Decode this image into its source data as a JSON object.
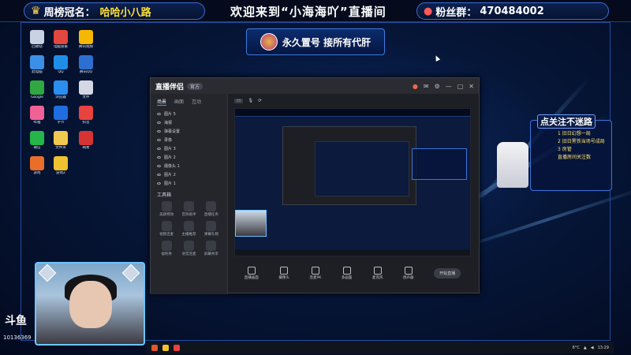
{
  "header": {
    "rank_label": "周榜冠名：",
    "rank_value": "哈哈小八路",
    "welcome": "欢迎来到“小海海吖”直播间",
    "fans_label": "粉丝群：",
    "fans_number": "470484002"
  },
  "banner": {
    "text": "永久置号 接所有代肝"
  },
  "desktop_icons": [
    {
      "label": "回收站",
      "color": "#c9d2e3"
    },
    {
      "label": "电脑管家",
      "color": "#e2483d"
    },
    {
      "label": "腾讯视频",
      "color": "#f5b700"
    },
    {
      "label": "此电脑",
      "color": "#3c8fe6"
    },
    {
      "label": "QQ",
      "color": "#1f8ee8"
    },
    {
      "label": "腾讯QQ",
      "color": "#2c6fd1"
    },
    {
      "label": "Google",
      "color": "#2fa844"
    },
    {
      "label": "浏览器",
      "color": "#2a8ef0"
    },
    {
      "label": "文件",
      "color": "#d3d8e4"
    },
    {
      "label": "哔哩",
      "color": "#f06296"
    },
    {
      "label": "字节",
      "color": "#1f6de0"
    },
    {
      "label": "抖音",
      "color": "#e9423f"
    },
    {
      "label": "微信",
      "color": "#25b54a"
    },
    {
      "label": "文件夹",
      "color": "#f1c850"
    },
    {
      "label": "网易",
      "color": "#d63434"
    },
    {
      "label": "游戏",
      "color": "#e96e2a"
    },
    {
      "label": "游戏2",
      "color": "#f0c230"
    }
  ],
  "app": {
    "title": "直播伴侣",
    "version": "官方",
    "tabs": [
      "场景",
      "画面",
      "互动"
    ],
    "scenes": [
      "图片 5",
      "海报",
      "弹幕设置",
      "录像",
      "图片 3",
      "图片 2",
      "摄像头 1",
      "图片 2",
      "图片 1"
    ],
    "tools_section": "工具箱",
    "tools": [
      "美颜特效",
      "音效助手",
      "直播任务",
      "视频连麦",
      "主播推荐",
      "弹幕礼物",
      "福利秀",
      "语音连麦",
      "屏幕共享"
    ],
    "bottom_controls": [
      "直播画面",
      "摄像头",
      "连麦PK",
      "多画面",
      "麦克风",
      "扬声器"
    ],
    "start_button": "开始直播"
  },
  "promo": {
    "title": "点关注不迷路",
    "lines": [
      "1 旧日幻想一局",
      "2 旧日黑铁当场号成局",
      "3 房管",
      "直播房间关注数"
    ]
  },
  "stream": {
    "platform": "斗鱼",
    "room_id": "10136369"
  },
  "taskbar": {
    "temp": "6°C",
    "time": "13:29"
  }
}
